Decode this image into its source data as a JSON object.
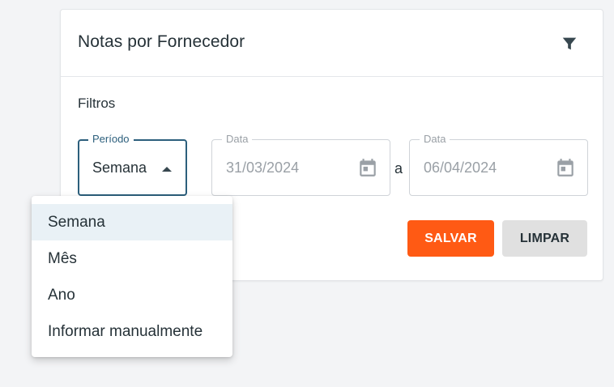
{
  "card": {
    "title": "Notas por Fornecedor",
    "filter_icon": "filter-icon"
  },
  "filters": {
    "section_title": "Filtros",
    "period": {
      "label": "Período",
      "value": "Semana"
    },
    "start_date": {
      "label": "Data",
      "value": "31/03/2024",
      "icon": "calendar-icon"
    },
    "separator": "a",
    "end_date": {
      "label": "Data",
      "value": "06/04/2024",
      "icon": "calendar-icon"
    }
  },
  "actions": {
    "save_label": "SALVAR",
    "clear_label": "LIMPAR"
  },
  "period_menu": {
    "options": [
      "Semana",
      "Mês",
      "Ano",
      "Informar manualmente"
    ],
    "selected": "Semana"
  },
  "colors": {
    "accent": "#ff5a14",
    "primary": "#2c5f7c",
    "selected_bg": "#e9f1f6"
  }
}
